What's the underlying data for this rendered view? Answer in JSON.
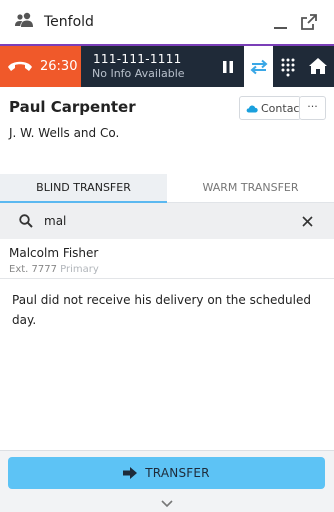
{
  "header": {
    "app_title": "Tenfold",
    "icons": [
      "people-icon",
      "minimize-icon",
      "popout-icon"
    ]
  },
  "call": {
    "timer": "26:30",
    "number": "111-111-1111",
    "info": "No Info Available",
    "accent_color": "#f0592a",
    "bar_color": "#1f2a38",
    "icons": [
      "hangup-icon",
      "pause-icon",
      "transfer-icon",
      "keypad-icon",
      "home-icon"
    ]
  },
  "contact": {
    "name": "Paul Carpenter",
    "company": "J. W. Wells and Co.",
    "contact_button": "Contact",
    "more_button": "···"
  },
  "tabs": [
    {
      "label": "BLIND TRANSFER",
      "active": true
    },
    {
      "label": "WARM TRANSFER",
      "active": false
    }
  ],
  "search": {
    "value": "mal",
    "placeholder": ""
  },
  "results": [
    {
      "name": "Malcolm Fisher",
      "ext": "Ext. 7777",
      "tag": "Primary"
    }
  ],
  "note": "Paul did not receive his delivery on the scheduled day.",
  "footer": {
    "transfer_label": "TRANSFER",
    "button_color": "#5dc3f5"
  }
}
